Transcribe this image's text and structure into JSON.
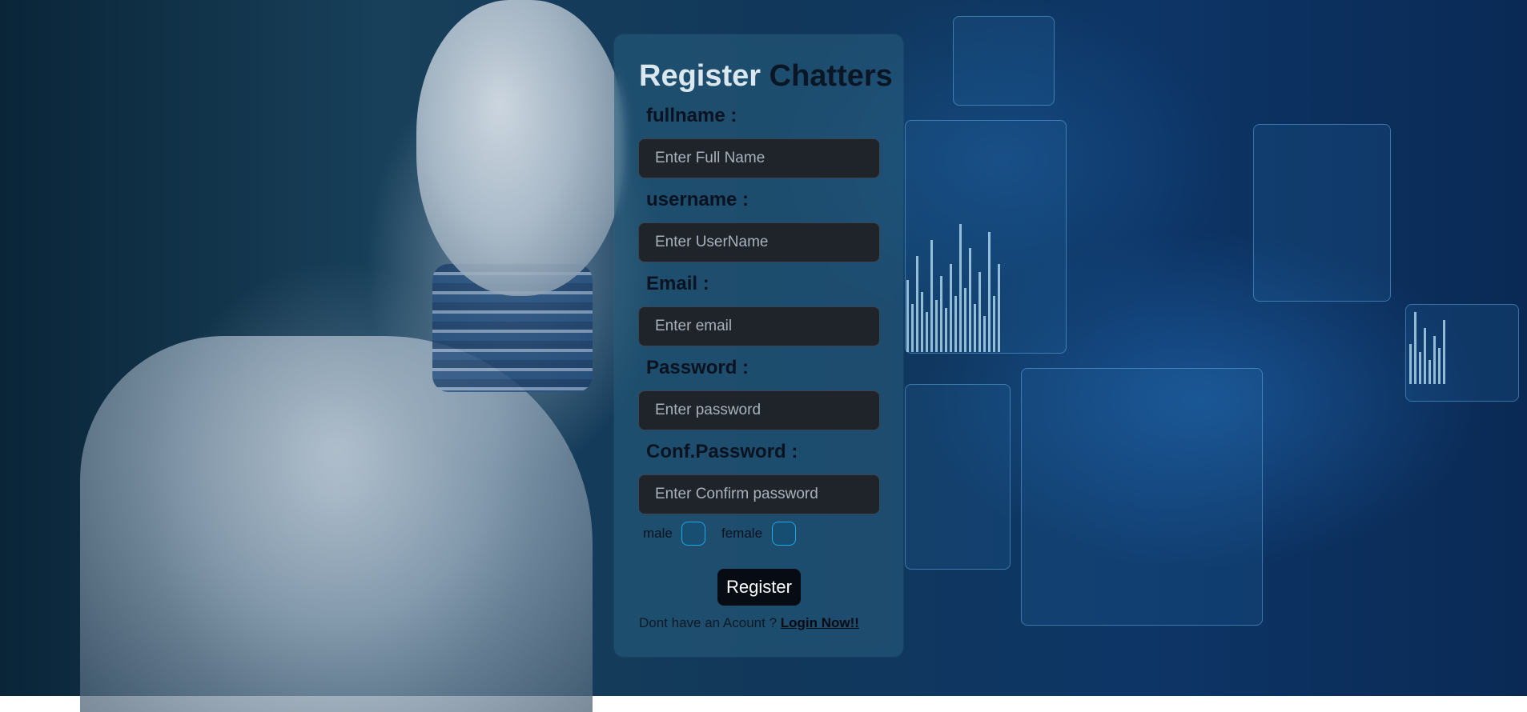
{
  "form": {
    "title_word1": "Register",
    "title_word2": "Chatters",
    "fields": [
      {
        "label": "fullname :",
        "placeholder": "Enter Full Name"
      },
      {
        "label": "username :",
        "placeholder": "Enter UserName"
      },
      {
        "label": "Email :",
        "placeholder": "Enter email"
      },
      {
        "label": "Password :",
        "placeholder": "Enter password"
      },
      {
        "label": "Conf.Password :",
        "placeholder": "Enter Confirm password"
      }
    ],
    "gender": {
      "male_label": "male",
      "female_label": "female"
    },
    "register_label": "Register",
    "footer_text": "Dont have an Acount ?",
    "login_link": "Login Now!!"
  },
  "colors": {
    "title_accent": "#dbe7ee",
    "title_dark": "#0b1624",
    "input_bg": "#1f232a",
    "checkbox_border": "#22a7e6",
    "button_bg": "#070b14"
  }
}
